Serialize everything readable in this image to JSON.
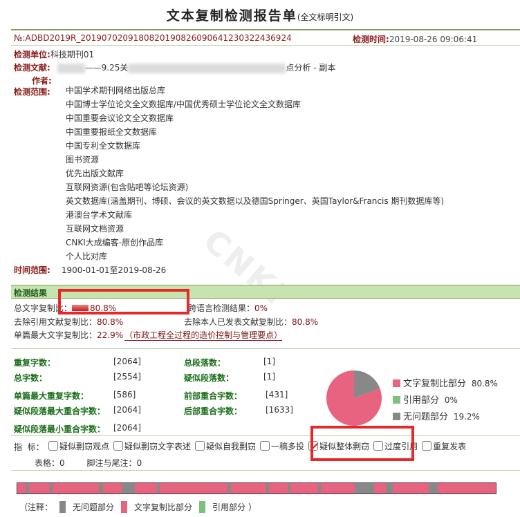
{
  "report": {
    "title": "文本复制检测报告单",
    "subtitle": "(全文标明引文)",
    "id": "№:ADBD2019R_20190702091808201908260906412303224369​24",
    "check_time_label": "检测时间:",
    "check_time": "2019-08-26 09:06:41"
  },
  "meta": {
    "unit_label": "检测单位:",
    "unit": "科技期刊01",
    "doc_label": "检测文献:",
    "doc_part1": "——9.25关",
    "doc_part2": "点分析 - 副本",
    "author_label": "作者:",
    "scope_label": "检测范围:",
    "scope_items": [
      "中国学术期刊网络出版总库",
      "中国博士学位论文全文数据库/中国优秀硕士学位论文全文数据库",
      "中国重要会议论文全文数据库",
      "中国重要报纸全文数据库",
      "中国专利全文数据库",
      "图书资源",
      "优先出版文献库",
      "互联网资源(包含贴吧等论坛资源)",
      "英文数据库(涵盖期刊、博硕、会议的英文数据以及德国Springer、英国Taylor&Francis 期刊数据库等)",
      "港澳台学术文献库",
      "互联网文档资源",
      "CNKI大成编客-原创作品库",
      "个人比对库"
    ],
    "time_label": "时间范围:",
    "time_range": "1900-01-01至2019-08-26"
  },
  "result": {
    "section_title": "检测结果",
    "total_copy_label": "总文字复制比：",
    "total_copy_value": "80.8%",
    "total_copy_fraction": 0.808,
    "cross_lang_label": "跨语言检测结果：",
    "cross_lang_value": "0%",
    "excl_ref_label": "去除引用文献复制比：",
    "excl_ref_value": "80.8%",
    "excl_self_label": "去除本人已发表文献复制比：",
    "excl_self_value": "80.8%",
    "max_single_label": "单篇最大文字复制比：",
    "max_single_value": "22.9%",
    "max_single_source": "（市政工程全过程的造价控制与管理要点）"
  },
  "stats": {
    "repeat_chars_label": "重复字数：",
    "repeat_chars": "[2064]",
    "total_paras_label": "总段落数：",
    "total_paras": "[1]",
    "total_chars_label": "总字数：",
    "total_chars": "[2554]",
    "sus_paras_label": "疑似段落数：",
    "sus_paras": "[1]",
    "max_repeat_label": "单篇最大重复字数：",
    "max_repeat": "[586]",
    "front_overlap_label": "前部重合字数：",
    "front_overlap": "[431]",
    "sus_max_label": "疑似段落最大重合字数：",
    "sus_max": "[2064]",
    "back_overlap_label": "后部重合字数：",
    "back_overlap": "[1633]",
    "sus_min_label": "疑似段落最小重合字数：",
    "sus_min": "[2064]"
  },
  "pie": {
    "legend": [
      {
        "label": "文字复制比部分",
        "value": "80.8%",
        "color": "#e8637f"
      },
      {
        "label": "引用部分",
        "value": "0%",
        "color": "#7fbf7f"
      },
      {
        "label": "无问题部分",
        "value": "19.2%",
        "color": "#888888"
      }
    ],
    "fractions": [
      0.808,
      0.0,
      0.192
    ]
  },
  "indicators": {
    "label": "指  标：",
    "items": [
      {
        "label": "疑似剽窃观点",
        "checked": false
      },
      {
        "label": "疑似剽窃文字表述",
        "checked": false
      },
      {
        "label": "疑似自我剽窃",
        "checked": false
      },
      {
        "label": "一稿多投",
        "checked": false
      },
      {
        "label": "疑似整体剽窃",
        "checked": true
      },
      {
        "label": "过度引用",
        "checked": false
      },
      {
        "label": "重复发表",
        "checked": false
      }
    ],
    "table_label": "表格：",
    "table_value": "0",
    "foot_label": "脚注与尾注：",
    "foot_value": "0"
  },
  "bar": {
    "segments": [
      {
        "start": 0.0,
        "end": 0.018,
        "kind": "copy"
      },
      {
        "start": 0.018,
        "end": 0.024,
        "kind": "none"
      },
      {
        "start": 0.024,
        "end": 0.068,
        "kind": "copy"
      },
      {
        "start": 0.068,
        "end": 0.074,
        "kind": "none"
      },
      {
        "start": 0.074,
        "end": 0.17,
        "kind": "copy"
      },
      {
        "start": 0.17,
        "end": 0.179,
        "kind": "none"
      },
      {
        "start": 0.179,
        "end": 0.218,
        "kind": "copy"
      },
      {
        "start": 0.218,
        "end": 0.246,
        "kind": "none"
      },
      {
        "start": 0.246,
        "end": 0.292,
        "kind": "copy"
      },
      {
        "start": 0.292,
        "end": 0.298,
        "kind": "none"
      },
      {
        "start": 0.298,
        "end": 0.44,
        "kind": "copy"
      },
      {
        "start": 0.44,
        "end": 0.446,
        "kind": "none"
      },
      {
        "start": 0.446,
        "end": 0.52,
        "kind": "copy"
      },
      {
        "start": 0.52,
        "end": 0.526,
        "kind": "none"
      },
      {
        "start": 0.526,
        "end": 0.565,
        "kind": "copy"
      },
      {
        "start": 0.565,
        "end": 0.571,
        "kind": "none"
      },
      {
        "start": 0.571,
        "end": 0.628,
        "kind": "copy"
      },
      {
        "start": 0.628,
        "end": 0.634,
        "kind": "none"
      },
      {
        "start": 0.634,
        "end": 0.705,
        "kind": "copy"
      },
      {
        "start": 0.705,
        "end": 0.745,
        "kind": "none"
      },
      {
        "start": 0.745,
        "end": 0.77,
        "kind": "copy"
      },
      {
        "start": 0.77,
        "end": 0.785,
        "kind": "none"
      },
      {
        "start": 0.785,
        "end": 0.86,
        "kind": "copy"
      },
      {
        "start": 0.86,
        "end": 0.878,
        "kind": "none"
      },
      {
        "start": 0.878,
        "end": 1.0,
        "kind": "copy"
      }
    ],
    "colors": {
      "copy": "#e8637f",
      "none": "#888888",
      "ref": "#7fbf7f"
    },
    "note_open": "（注释：",
    "note_none": "无问题部分",
    "note_copy": "文字复制比部分",
    "note_ref": "引用部分",
    "note_close": "）"
  }
}
